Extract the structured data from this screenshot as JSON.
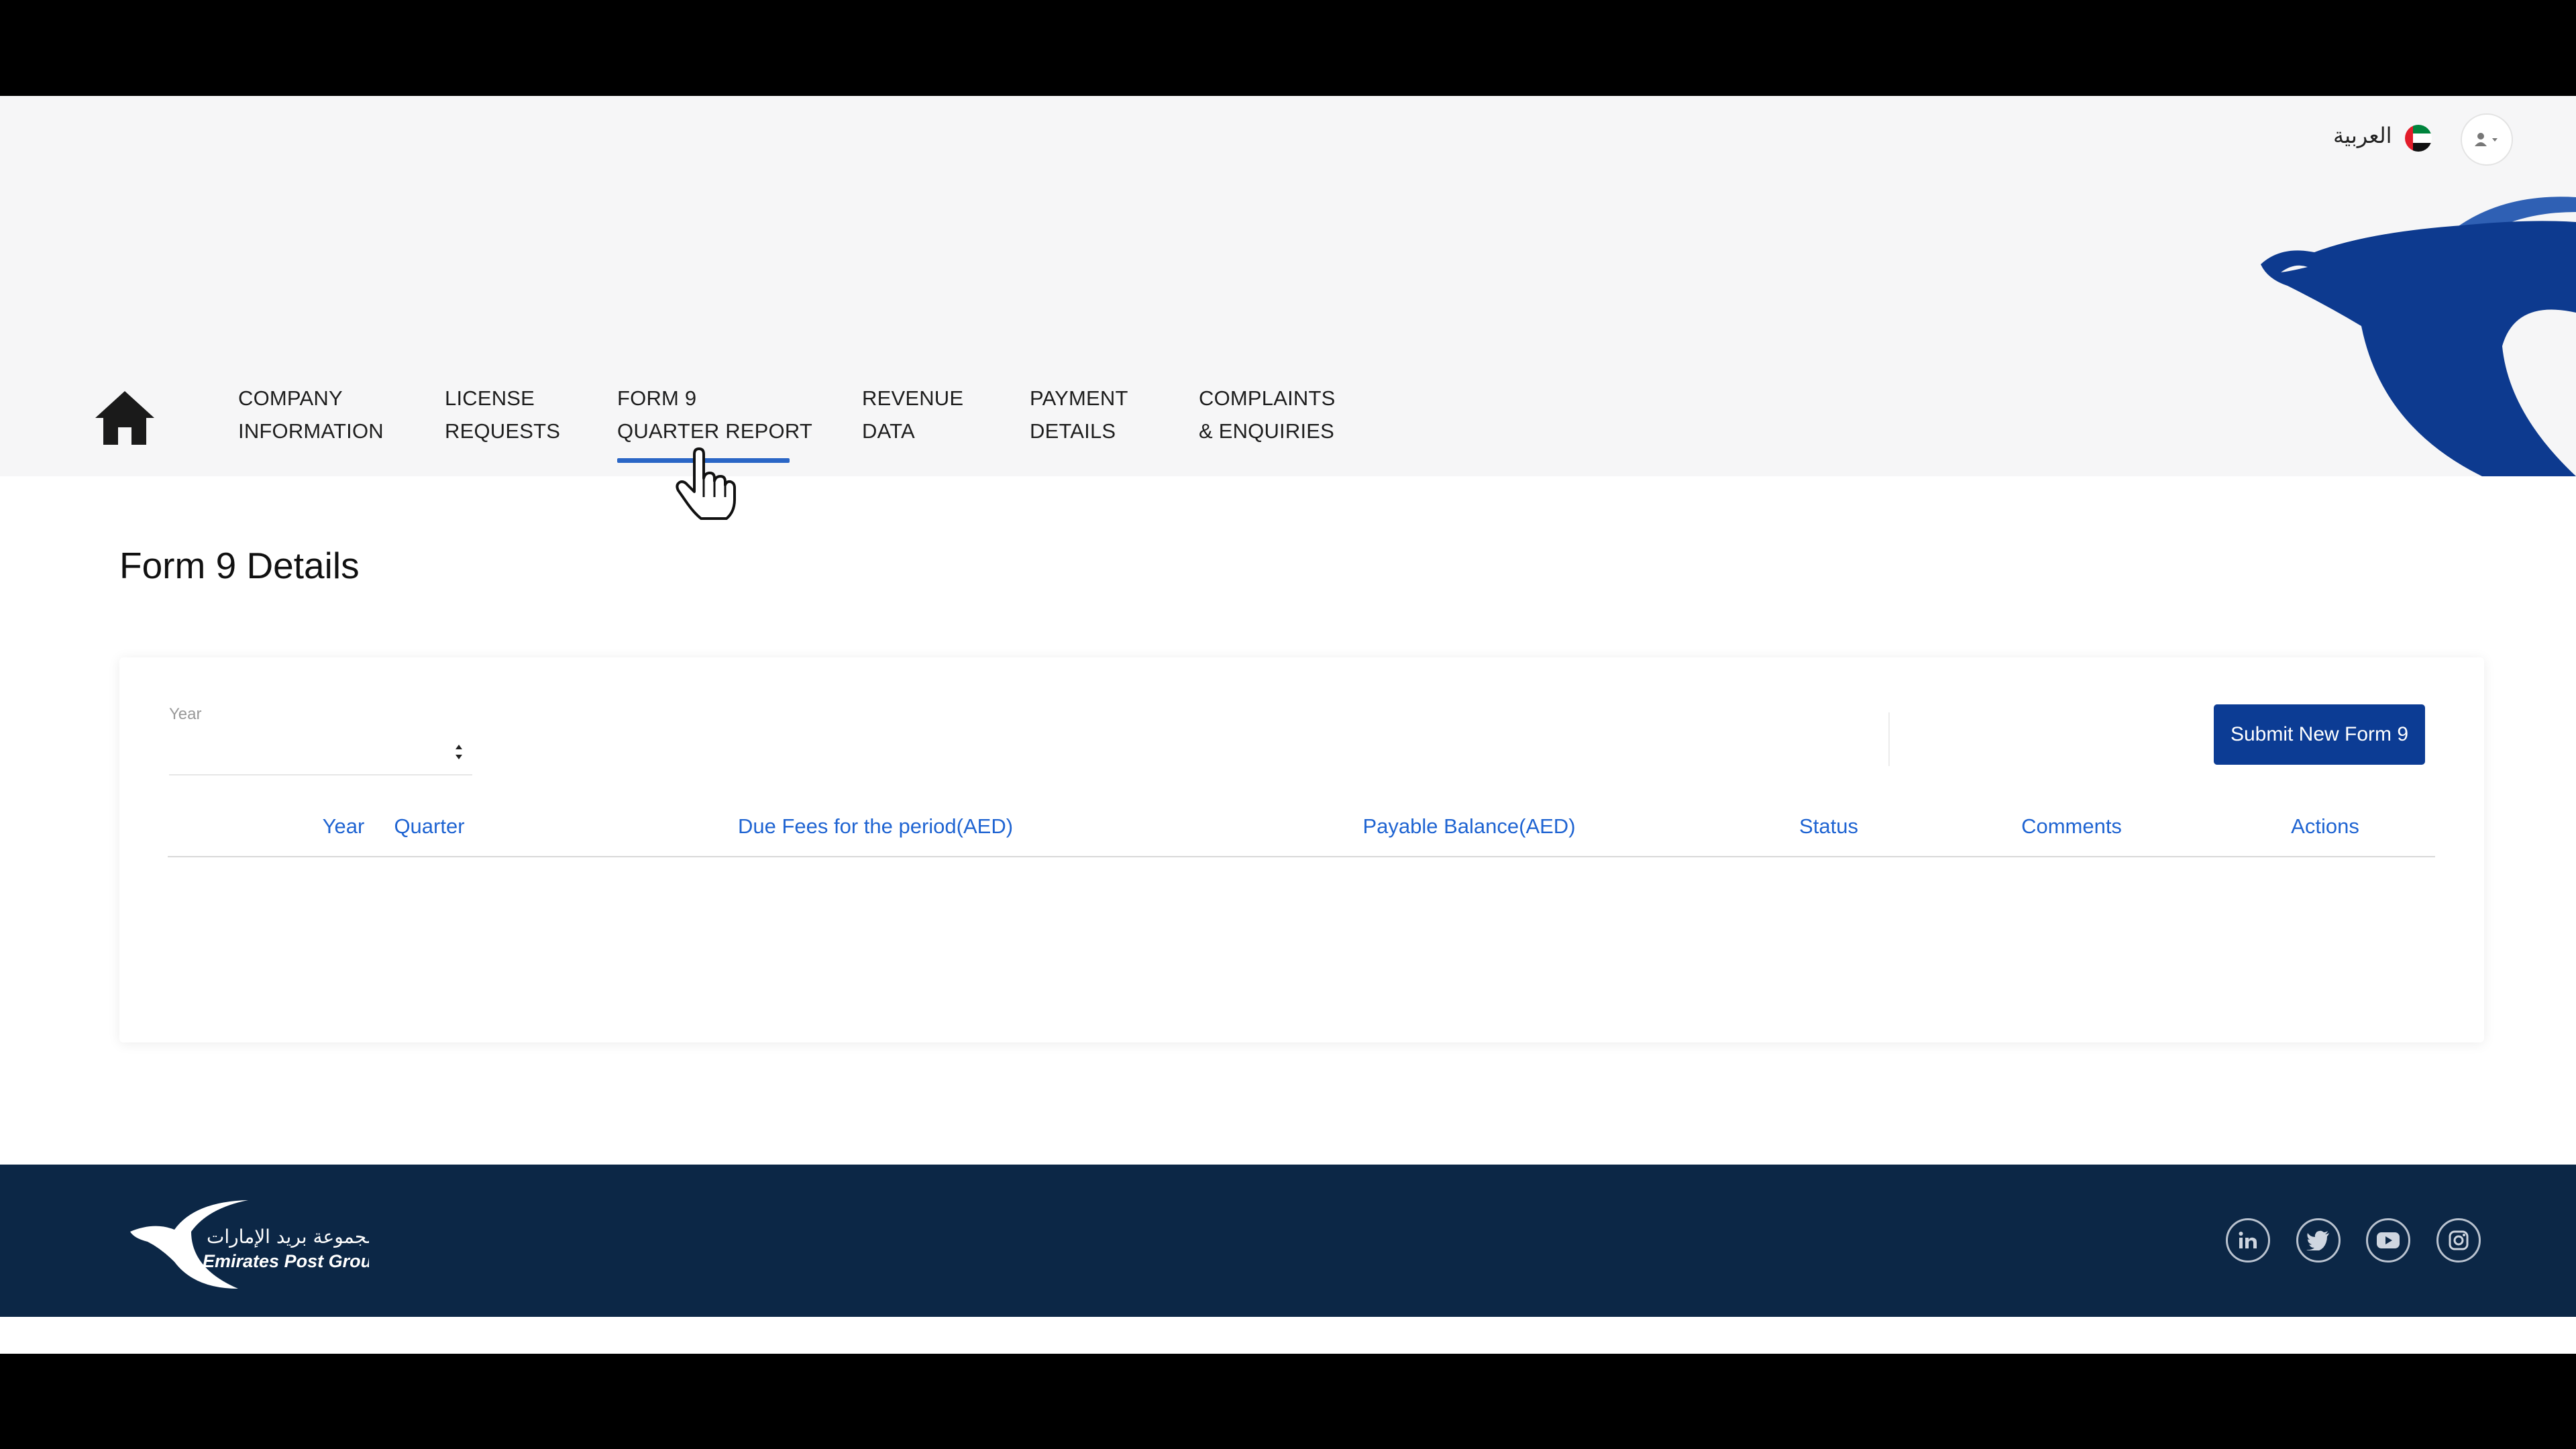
{
  "header": {
    "language_label": "العربية",
    "flag_icon": "uae-flag-icon",
    "user_icon": "user-icon",
    "brand_color": "#0c3c94"
  },
  "nav": {
    "items": [
      {
        "line1": "COMPANY",
        "line2": "INFORMATION"
      },
      {
        "line1": "LICENSE",
        "line2": "REQUESTS"
      },
      {
        "line1": "FORM 9",
        "line2": "QUARTER REPORT",
        "active": true
      },
      {
        "line1": "REVENUE",
        "line2": "DATA"
      },
      {
        "line1": "PAYMENT",
        "line2": "DETAILS"
      },
      {
        "line1": "COMPLAINTS",
        "line2": "& ENQUIRIES"
      }
    ],
    "accent_color": "#2a66c6"
  },
  "main": {
    "title": "Form 9 Details",
    "year_filter": {
      "label": "Year",
      "value": ""
    },
    "submit_label": "Submit New Form 9",
    "table": {
      "columns": [
        "Year",
        "Quarter",
        "Due Fees for the period(AED)",
        "Payable Balance(AED)",
        "Status",
        "Comments",
        "Actions"
      ],
      "rows": []
    }
  },
  "footer": {
    "logo_arabic": "مجموعة بريد الإمارات",
    "logo_english": "Emirates Post Group",
    "social": [
      "linkedin-icon",
      "twitter-icon",
      "youtube-icon",
      "instagram-icon"
    ],
    "background": "#0c2746"
  }
}
